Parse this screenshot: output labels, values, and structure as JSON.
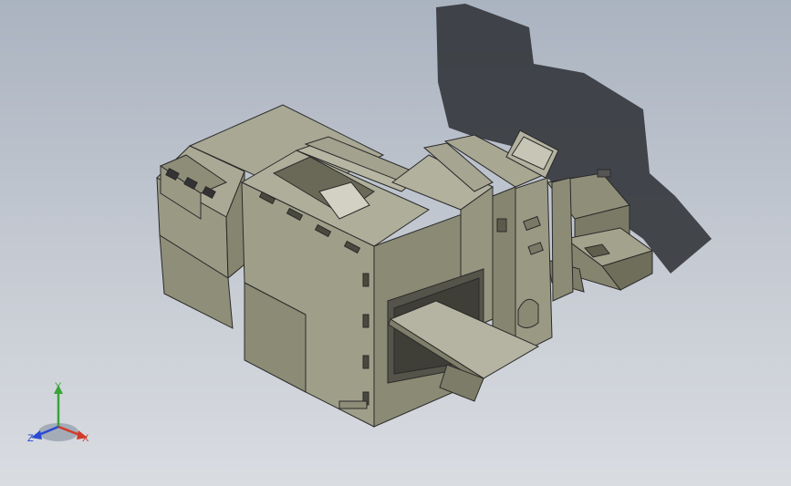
{
  "viewport": {
    "background_top": "#aab3c0",
    "background_bottom": "#d9dce1"
  },
  "model": {
    "body_color": "#9d9c86",
    "edge_color": "#2a2a2a",
    "shadow_color": "#2b2e33"
  },
  "triad": {
    "x_label": "X",
    "y_label": "Y",
    "z_label": "Z",
    "x_color": "#d23a2a",
    "y_color": "#3aa43a",
    "z_color": "#2a4ad2"
  }
}
